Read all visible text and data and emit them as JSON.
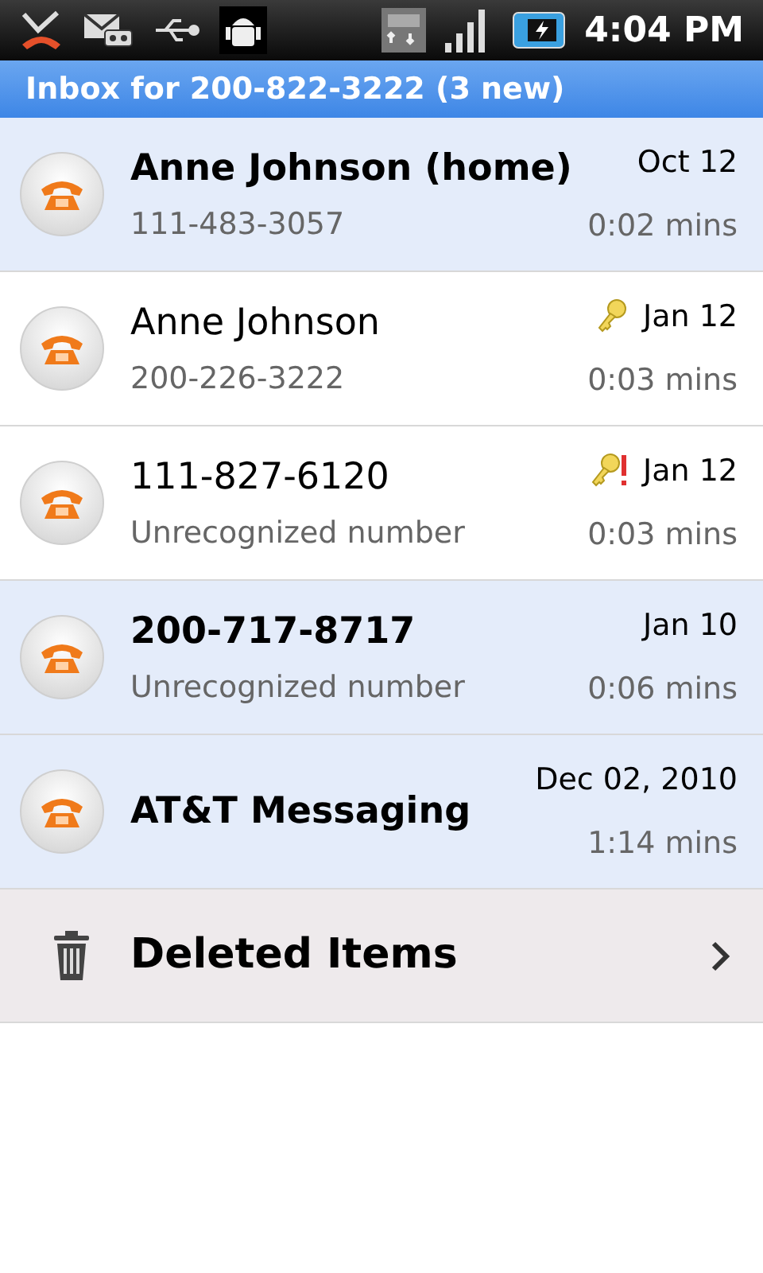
{
  "status_bar": {
    "time": "4:04 PM"
  },
  "header": {
    "title": "Inbox for 200-822-3222 (3 new)"
  },
  "messages": [
    {
      "name": "Anne Johnson (home)",
      "subtitle": "111-483-3057",
      "date": "Oct 12",
      "duration": "0:02 mins",
      "unread": true,
      "kind": "plain"
    },
    {
      "name": "Anne Johnson",
      "subtitle": "200-226-3222",
      "date": "Jan 12",
      "duration": "0:03 mins",
      "unread": false,
      "kind": "key"
    },
    {
      "name": "111-827-6120",
      "subtitle": "Unrecognized number",
      "date": "Jan 12",
      "duration": "0:03 mins",
      "unread": false,
      "kind": "key_alert"
    },
    {
      "name": "200-717-8717",
      "subtitle": "Unrecognized number",
      "date": "Jan 10",
      "duration": "0:06 mins",
      "unread": true,
      "kind": "plain"
    },
    {
      "name": "AT&T Messaging",
      "date": "Dec 02, 2010",
      "duration": "1:14 mins",
      "unread": true,
      "kind": "plain"
    }
  ],
  "deleted": {
    "label": "Deleted Items"
  }
}
